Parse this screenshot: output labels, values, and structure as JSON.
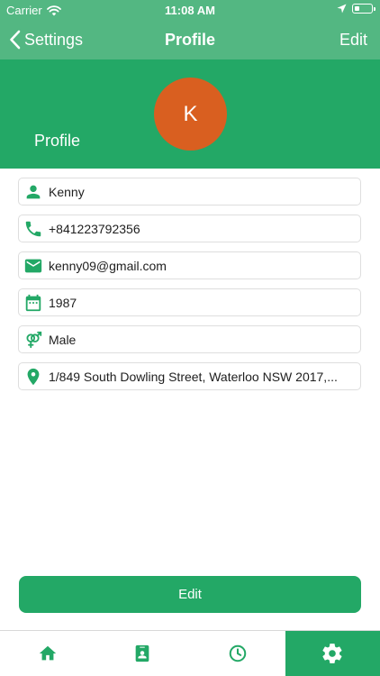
{
  "status_bar": {
    "carrier": "Carrier",
    "time": "11:08 AM",
    "battery_fraction": 0.35
  },
  "nav": {
    "back_label": "Settings",
    "title": "Profile",
    "edit_label": "Edit"
  },
  "header": {
    "label": "Profile",
    "avatar_initial": "K",
    "avatar_color": "#d95f20"
  },
  "fields": [
    {
      "icon": "person-icon",
      "value": "Kenny"
    },
    {
      "icon": "phone-icon",
      "value": "+841223792356"
    },
    {
      "icon": "email-icon",
      "value": "kenny09@gmail.com"
    },
    {
      "icon": "calendar-icon",
      "value": "1987"
    },
    {
      "icon": "gender-icon",
      "value": "Male"
    },
    {
      "icon": "location-pin-icon",
      "value": "1/849 South Dowling Street, Waterloo NSW 2017,..."
    }
  ],
  "actions": {
    "edit_button_label": "Edit"
  },
  "tab_bar": {
    "tabs": [
      {
        "icon": "home-icon",
        "active": false
      },
      {
        "icon": "contacts-icon",
        "active": false
      },
      {
        "icon": "clock-icon",
        "active": false
      },
      {
        "icon": "gear-icon",
        "active": true
      }
    ]
  },
  "colors": {
    "nav_green": "#53b782",
    "primary_green": "#23a866",
    "icon_green": "#23a866"
  }
}
